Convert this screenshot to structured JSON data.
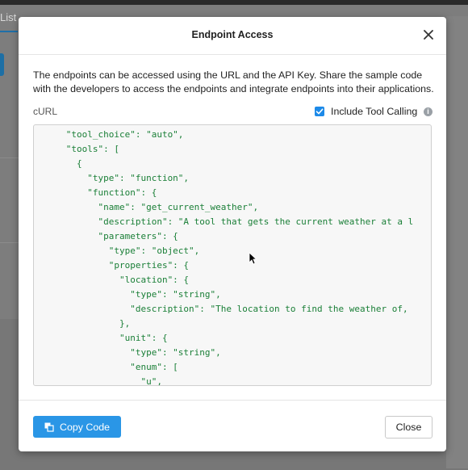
{
  "background": {
    "tab_label": "List"
  },
  "dialog": {
    "title": "Endpoint Access",
    "close_icon": "close-icon",
    "description": "The endpoints can be accessed using the URL and the API Key. Share the sample code with the developers to access the endpoints and integrate endpoints into their applications.",
    "code_label": "cURL",
    "tool_calling": {
      "label": "Include Tool Calling",
      "checked": true,
      "info_icon": "info-icon"
    },
    "code_lines": [
      "      \"tool_choice\": \"auto\",",
      "      \"tools\": [",
      "        {",
      "          \"type\": \"function\",",
      "          \"function\": {",
      "            \"name\": \"get_current_weather\",",
      "            \"description\": \"A tool that gets the current weather at a l",
      "            \"parameters\": {",
      "              \"type\": \"object\",",
      "              \"properties\": {",
      "                \"location\": {",
      "                  \"type\": \"string\",",
      "                  \"description\": \"The location to find the weather of,",
      "                },",
      "                \"unit\": {",
      "                  \"type\": \"string\",",
      "                  \"enum\": [",
      "                    \"u\","
    ],
    "copy_button": {
      "label": "Copy Code",
      "icon": "copy-icon"
    },
    "close_button": {
      "label": "Close"
    }
  },
  "colors": {
    "accent": "#2a96e6",
    "code_text": "#1a7f37"
  }
}
